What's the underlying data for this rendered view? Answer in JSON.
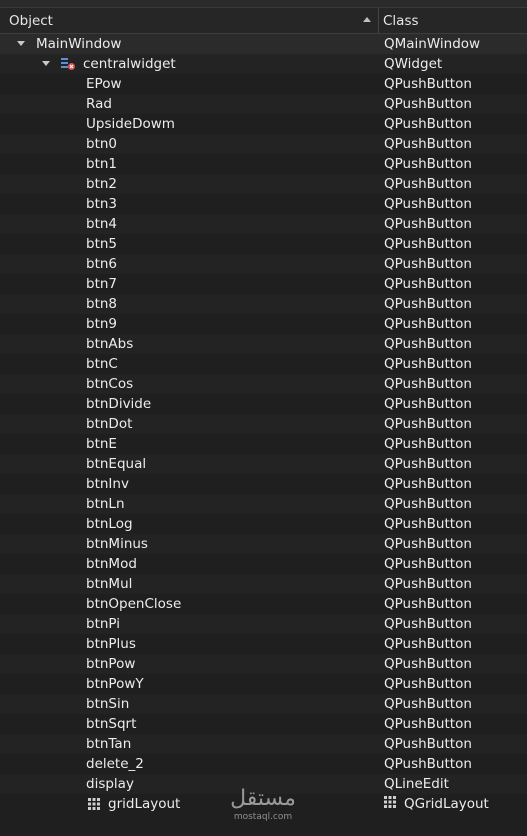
{
  "header": {
    "object": "Object",
    "class": "Class"
  },
  "tree": [
    {
      "name": "MainWindow",
      "class": "QMainWindow",
      "level": 0,
      "expanded": true,
      "icon": ""
    },
    {
      "name": "centralwidget",
      "class": "QWidget",
      "level": 1,
      "expanded": true,
      "icon": "widget-icon"
    },
    {
      "name": "EPow",
      "class": "QPushButton",
      "level": 2
    },
    {
      "name": "Rad",
      "class": "QPushButton",
      "level": 2
    },
    {
      "name": "UpsideDowm",
      "class": "QPushButton",
      "level": 2
    },
    {
      "name": "btn0",
      "class": "QPushButton",
      "level": 2
    },
    {
      "name": "btn1",
      "class": "QPushButton",
      "level": 2
    },
    {
      "name": "btn2",
      "class": "QPushButton",
      "level": 2
    },
    {
      "name": "btn3",
      "class": "QPushButton",
      "level": 2
    },
    {
      "name": "btn4",
      "class": "QPushButton",
      "level": 2
    },
    {
      "name": "btn5",
      "class": "QPushButton",
      "level": 2
    },
    {
      "name": "btn6",
      "class": "QPushButton",
      "level": 2
    },
    {
      "name": "btn7",
      "class": "QPushButton",
      "level": 2
    },
    {
      "name": "btn8",
      "class": "QPushButton",
      "level": 2
    },
    {
      "name": "btn9",
      "class": "QPushButton",
      "level": 2
    },
    {
      "name": "btnAbs",
      "class": "QPushButton",
      "level": 2
    },
    {
      "name": "btnC",
      "class": "QPushButton",
      "level": 2
    },
    {
      "name": "btnCos",
      "class": "QPushButton",
      "level": 2
    },
    {
      "name": "btnDivide",
      "class": "QPushButton",
      "level": 2
    },
    {
      "name": "btnDot",
      "class": "QPushButton",
      "level": 2
    },
    {
      "name": "btnE",
      "class": "QPushButton",
      "level": 2
    },
    {
      "name": "btnEqual",
      "class": "QPushButton",
      "level": 2
    },
    {
      "name": "btnInv",
      "class": "QPushButton",
      "level": 2
    },
    {
      "name": "btnLn",
      "class": "QPushButton",
      "level": 2
    },
    {
      "name": "btnLog",
      "class": "QPushButton",
      "level": 2
    },
    {
      "name": "btnMinus",
      "class": "QPushButton",
      "level": 2
    },
    {
      "name": "btnMod",
      "class": "QPushButton",
      "level": 2
    },
    {
      "name": "btnMul",
      "class": "QPushButton",
      "level": 2
    },
    {
      "name": "btnOpenClose",
      "class": "QPushButton",
      "level": 2
    },
    {
      "name": "btnPi",
      "class": "QPushButton",
      "level": 2
    },
    {
      "name": "btnPlus",
      "class": "QPushButton",
      "level": 2
    },
    {
      "name": "btnPow",
      "class": "QPushButton",
      "level": 2
    },
    {
      "name": "btnPowY",
      "class": "QPushButton",
      "level": 2
    },
    {
      "name": "btnSin",
      "class": "QPushButton",
      "level": 2
    },
    {
      "name": "btnSqrt",
      "class": "QPushButton",
      "level": 2
    },
    {
      "name": "btnTan",
      "class": "QPushButton",
      "level": 2
    },
    {
      "name": "delete_2",
      "class": "QPushButton",
      "level": 2
    },
    {
      "name": "display",
      "class": "QLineEdit",
      "level": 2
    },
    {
      "name": "gridLayout",
      "class": "QGridLayout",
      "level": 2,
      "icon": "grid-layout-icon",
      "class_icon": "grid-layout-icon"
    }
  ],
  "watermark": {
    "arabic": "مستقل",
    "latin": "mostaql.com"
  },
  "colors": {
    "background": "#1f1f1f",
    "text": "#ececec",
    "icon_red": "#d9534f",
    "icon_blue": "#5b8fd6"
  }
}
